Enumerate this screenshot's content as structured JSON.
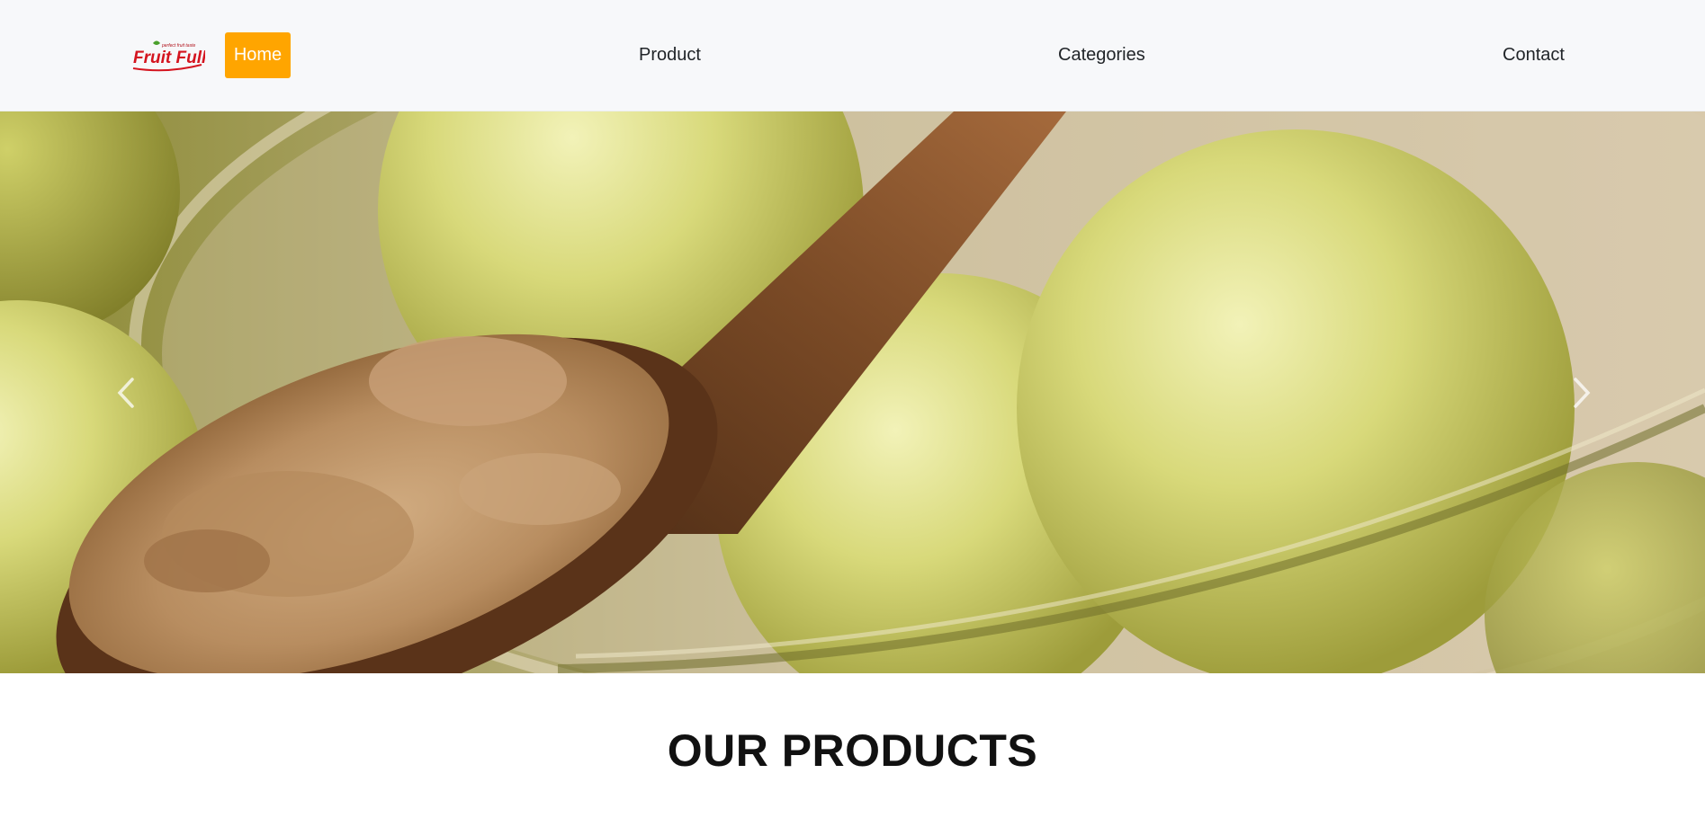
{
  "navbar": {
    "logo": {
      "brand": "Fruit Full",
      "tagline": "perfect fruit taste"
    },
    "home_label": "Home",
    "links": [
      {
        "label": "Product"
      },
      {
        "label": "Categories"
      },
      {
        "label": "Contact"
      }
    ],
    "active_color": "#ffa500"
  },
  "carousel": {
    "image": "amla-powder-on-wooden-spoon-with-amla-fruits-in-glass-bowl",
    "prev_icon": "chevron-left-icon",
    "next_icon": "chevron-right-icon"
  },
  "products": {
    "heading": "OUR PRODUCTS"
  }
}
